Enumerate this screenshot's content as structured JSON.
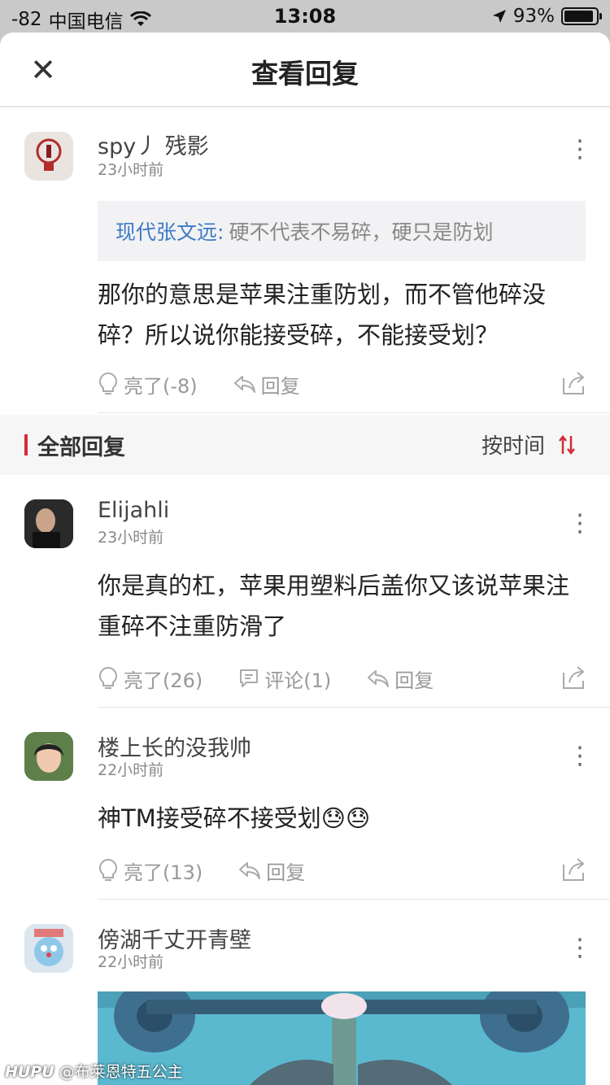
{
  "status": {
    "signal": "-82",
    "carrier": "中国电信",
    "time": "13:08",
    "battery": "93%",
    "battery_level": 0.93
  },
  "header": {
    "title": "查看回复",
    "close_icon": "close-icon"
  },
  "main_comment": {
    "username": "spy丿 残影",
    "time": "23小时前",
    "quote_name": "现代张文远:",
    "quote_text": "硬不代表不易碎，硬只是防划",
    "text": "那你的意思是苹果注重防划，而不管他碎没碎？所以说你能接受碎，不能接受划？",
    "like_label": "亮了(-8)",
    "reply_label": "回复"
  },
  "section": {
    "label": "全部回复",
    "sort_label": "按时间"
  },
  "replies": [
    {
      "username": "Elijahli",
      "time": "23小时前",
      "text": "你是真的杠，苹果用塑料后盖你又该说苹果注重碎不注重防滑了",
      "like_label": "亮了(26)",
      "comment_label": "评论(1)",
      "reply_label": "回复"
    },
    {
      "username": "楼上长的没我帅",
      "time": "22小时前",
      "text": "神TM接受碎不接受划😓😓",
      "like_label": "亮了(13)",
      "reply_label": "回复"
    },
    {
      "username": "傍湖千丈开青壁",
      "time": "22小时前"
    }
  ],
  "watermark": {
    "brand": "HUPU",
    "author": "@布莱恩特五公主"
  },
  "colors": {
    "accent_red": "#d42b37",
    "link_blue": "#3d7bc6"
  }
}
